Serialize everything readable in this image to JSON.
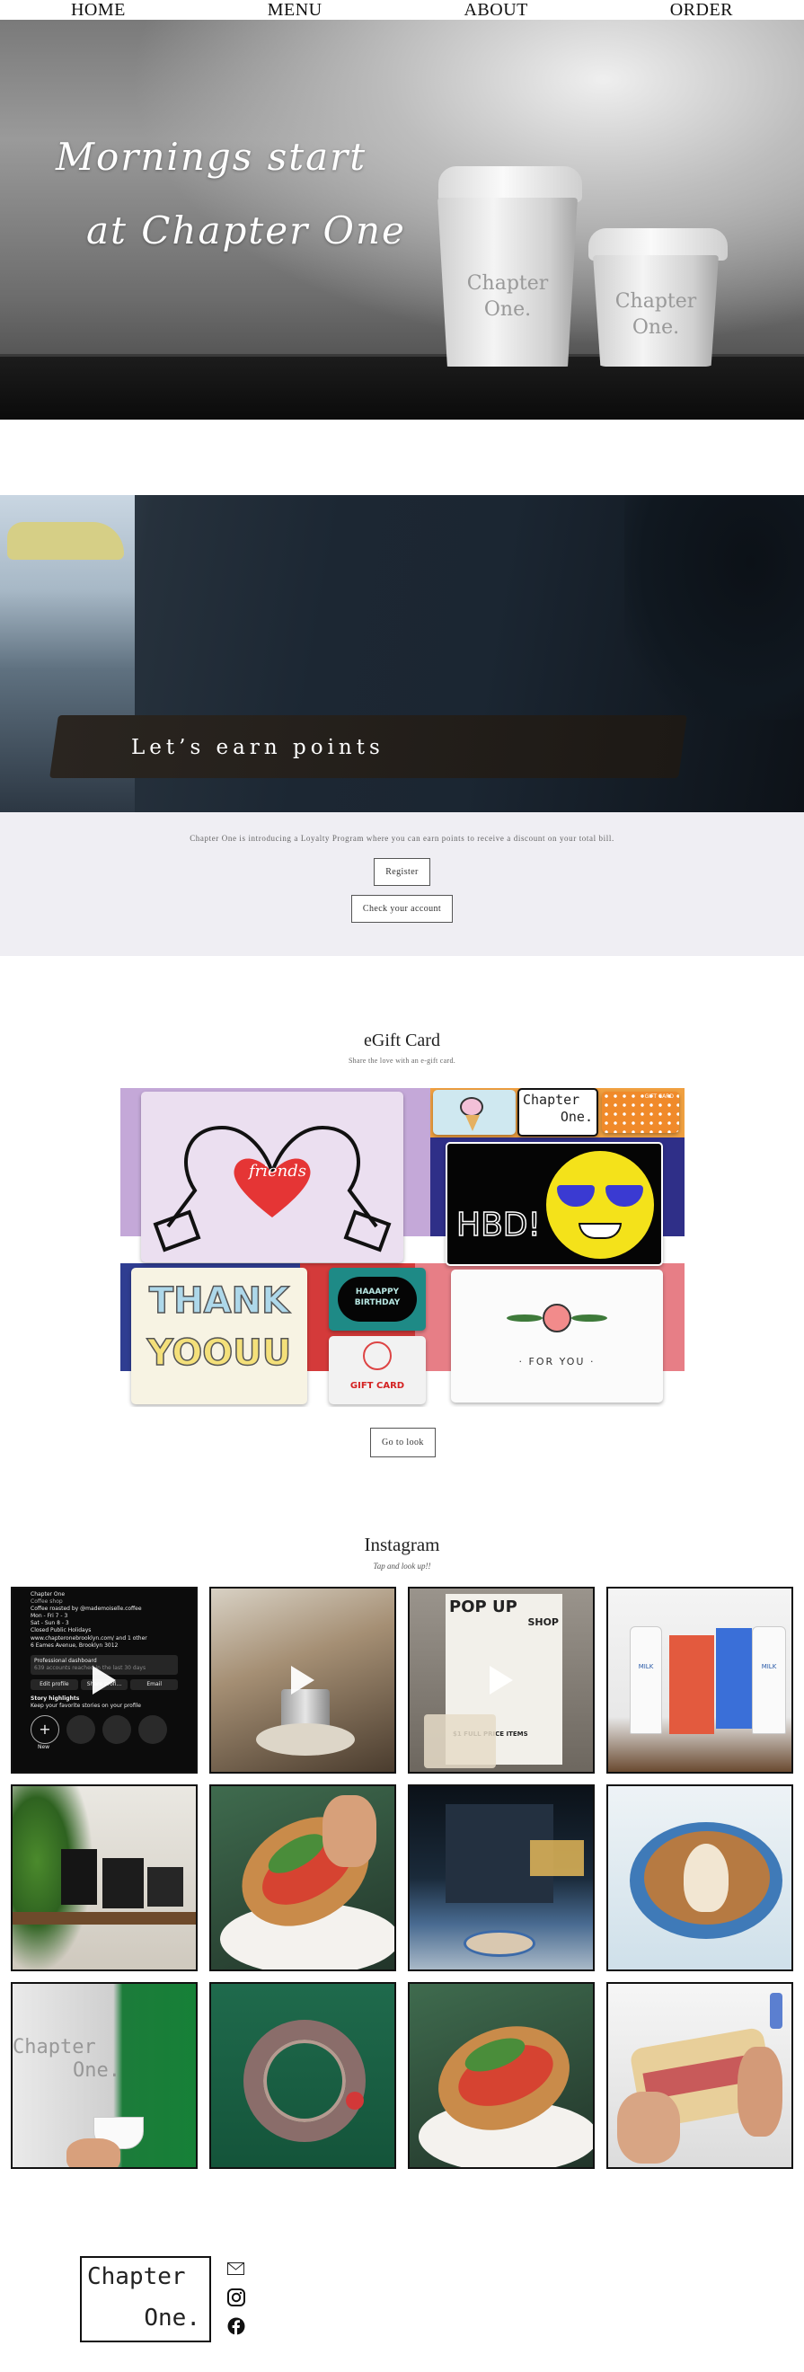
{
  "nav": {
    "items": [
      "HOME",
      "MENU",
      "ABOUT",
      "ORDER"
    ]
  },
  "hero": {
    "line1": "Mornings start",
    "line2": "at Chapter One",
    "cup_text": [
      "Chapter",
      "One."
    ]
  },
  "loyalty": {
    "banner_title": "Let’s earn points",
    "description": "Chapter One is introducing a Loyalty Program where you can earn points to receive a discount on your total bill.",
    "register_label": "Register",
    "check_label": "Check your account"
  },
  "egift": {
    "title": "eGift Card",
    "subtitle": "Share the love with an e-gift card.",
    "button_label": "Go to look",
    "cards": {
      "friends": "friends",
      "chapter_one": [
        "Chapter",
        "One."
      ],
      "gift_card_small": "GIFT CARD",
      "hbd": "HBD!",
      "thank": [
        "THANK",
        "YOOUU"
      ],
      "birthday": [
        "HAAAPPY",
        "BIRTHDAY"
      ],
      "gift_card": "GIFT CARD",
      "for_you": "· FOR YOU ·"
    }
  },
  "instagram": {
    "title": "Instagram",
    "subtitle": "Tap and look up!!",
    "profile_post": {
      "lines": [
        "Chapter One",
        "Coffee shop",
        "Coffee roasted by @mademoiselle.coffee",
        "Mon - Fri 7 - 3",
        "Sat - Sun 8 - 3",
        "Closed Public Holidays",
        "www.chapteronebrooklyn.com/ and 1 other",
        "6 Eames Avenue, Brooklyn 3012"
      ],
      "dashboard": "Professional dashboard",
      "dashboard_sub": "639 accounts reached in the last 30 days",
      "buttons": [
        "Edit profile",
        "Share profi...",
        "Email"
      ],
      "highlights": "Story highlights",
      "highlights_sub": "Keep your favorite stories on your profile",
      "new_label": "New"
    },
    "popup_post": {
      "title": "POP UP",
      "subtitle": "SHOP",
      "price": "$1 FULL PRICE ITEMS"
    },
    "milk_labels": [
      "MILK",
      "MILK"
    ],
    "logo_tile": [
      "Chapter",
      "One."
    ]
  },
  "footer": {
    "logo_line1": "Chapter",
    "logo_line2": "One."
  }
}
